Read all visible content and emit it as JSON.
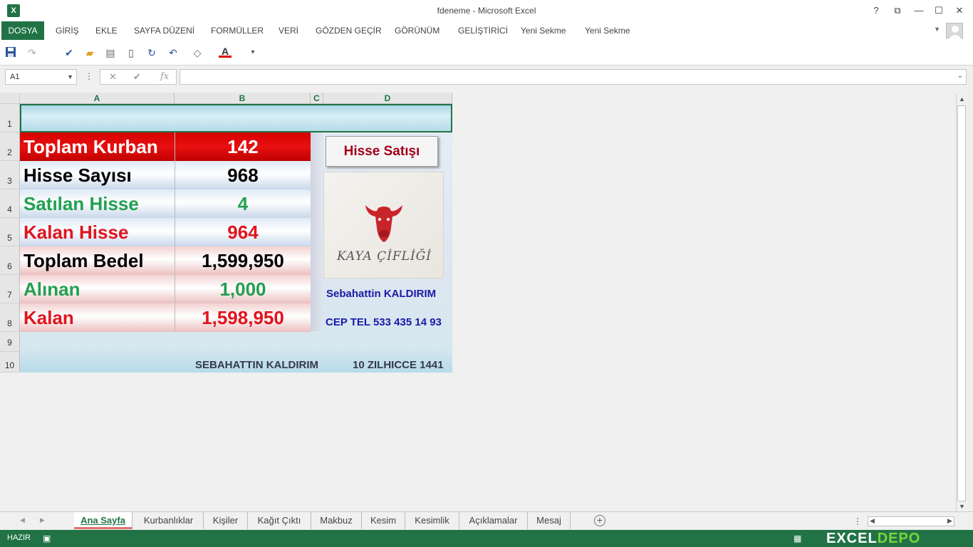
{
  "window": {
    "title": "fdeneme - Microsoft Excel",
    "logo": "X"
  },
  "window_controls": [
    "?",
    "⧉",
    "—",
    "☐",
    "✕"
  ],
  "ribbon": {
    "file_tab": "DOSYA",
    "tabs": [
      "GİRİŞ",
      "EKLE",
      "SAYFA DÜZENİ",
      "FORMÜLLER",
      "VERİ",
      "GÖZDEN GEÇİR",
      "GÖRÜNÜM",
      "GELİŞTİRİCİ",
      "Yeni Sekme",
      "Yeni Sekme"
    ]
  },
  "formula_bar": {
    "name_box": "A1",
    "cancel": "✕",
    "enter": "✔",
    "fx": "fx",
    "value": ""
  },
  "grid": {
    "columns": [
      "A",
      "B",
      "C",
      "D"
    ],
    "rows": [
      "1",
      "2",
      "3",
      "4",
      "5",
      "6",
      "7",
      "8",
      "9",
      "10"
    ]
  },
  "summary": [
    {
      "label": "Toplam Kurban",
      "value": "142"
    },
    {
      "label": "Hisse Sayısı",
      "value": "968"
    },
    {
      "label": "Satılan Hisse",
      "value": "4"
    },
    {
      "label": "Kalan Hisse",
      "value": "964"
    },
    {
      "label": "Toplam Bedel",
      "value": "1,599,950"
    },
    {
      "label": "Alınan",
      "value": "1,000"
    },
    {
      "label": "Kalan",
      "value": "1,598,950"
    }
  ],
  "colors": {
    "excel_green": "#217346",
    "red": "#d40000",
    "green_text": "#22a050",
    "red_text": "#e0141e",
    "black_text": "#000000",
    "contact_blue": "#1a1aa6",
    "button_text": "#a3001b"
  },
  "button": {
    "label": "Hisse Satışı"
  },
  "logo": {
    "text": "KAYA ÇİFLİĞİ",
    "icon": "cow-head-icon"
  },
  "contact": {
    "name": "Sebahattin KALDIRIM",
    "phone": "CEP TEL 533 435 14 93"
  },
  "footer": {
    "author": "SEBAHATTIN KALDIRIM",
    "date": "10 ZILHICCE 1441"
  },
  "sheet_tabs": [
    "Ana Sayfa",
    "Kurbanlıklar",
    "Kişiler",
    "Kağıt Çıktı",
    "Makbuz",
    "Kesim",
    "Kesimlik",
    "Açıklamalar",
    "Mesaj"
  ],
  "status": {
    "text": "HAZIR"
  },
  "brand": {
    "part1": "EXCEL",
    "part2": "DEPO"
  }
}
